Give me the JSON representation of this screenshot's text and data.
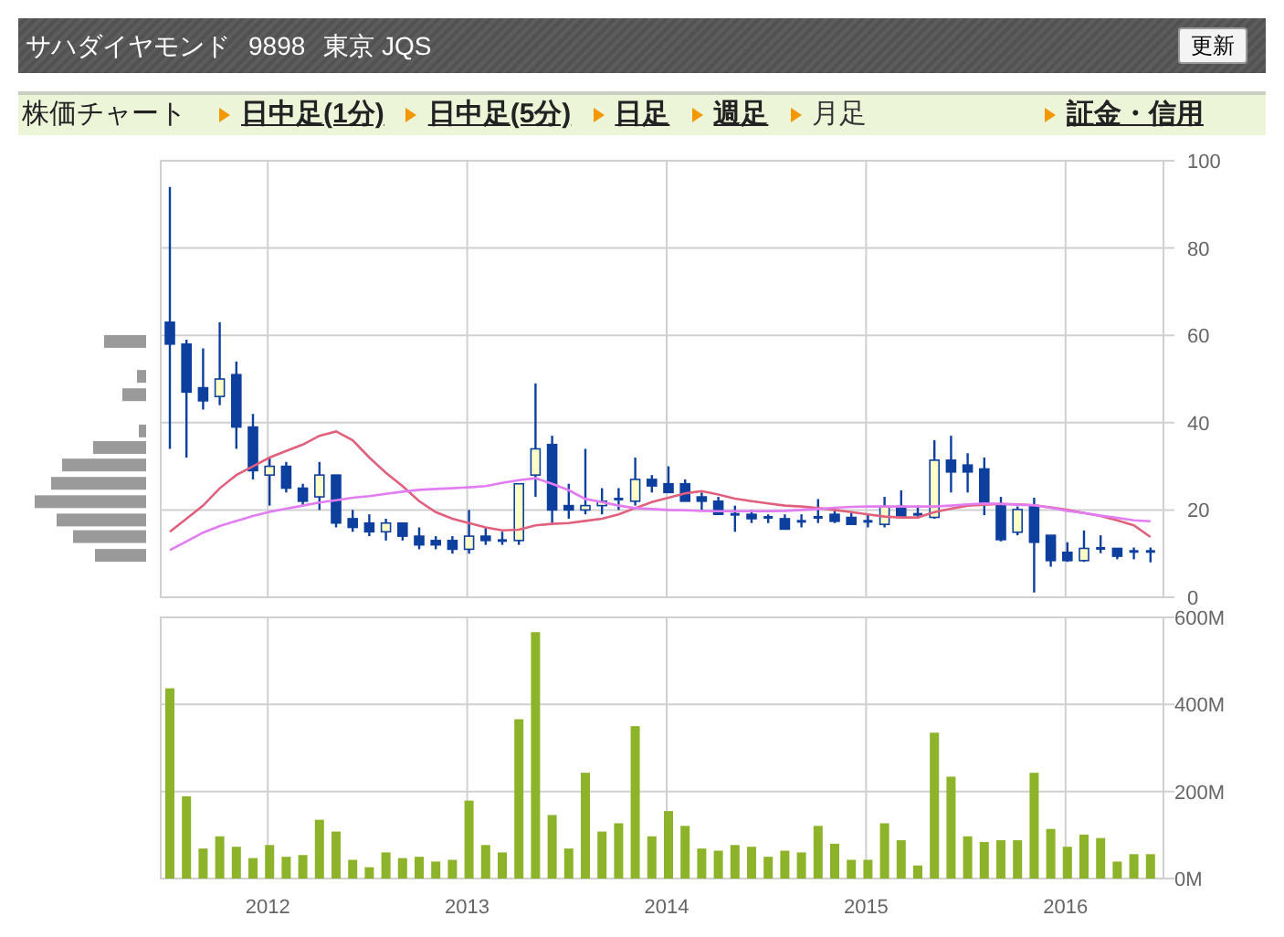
{
  "header": {
    "company": "サハダイヤモンド",
    "code": "9898",
    "market": "東京 JQS",
    "refresh_button": "更新"
  },
  "nav": {
    "label": "株価チャート",
    "links": [
      {
        "label": "日中足(1分)",
        "selected": false
      },
      {
        "label": "日中足(5分)",
        "selected": false
      },
      {
        "label": "日足",
        "selected": false
      },
      {
        "label": "週足",
        "selected": false
      },
      {
        "label": "月足",
        "selected": true
      },
      {
        "label": "証金・信用",
        "selected": false
      }
    ]
  },
  "price_chart": {
    "chart_data": {
      "type": "candlestick",
      "categories": [
        null,
        null,
        null,
        null,
        null,
        null,
        null,
        null,
        null,
        null,
        null,
        null,
        null,
        null,
        null,
        null,
        null,
        null,
        null,
        null,
        null,
        null,
        null,
        null,
        null,
        null,
        null,
        null,
        null,
        null,
        null,
        null,
        null,
        null,
        null,
        null,
        null,
        null,
        null,
        null,
        null,
        null,
        null,
        null,
        null,
        null,
        null,
        null,
        null,
        null,
        null,
        null,
        null,
        null,
        null,
        null,
        null,
        null,
        null,
        null
      ],
      "ylim": [
        0,
        100
      ],
      "yticks": [
        {
          "value": 0,
          "label": "0"
        },
        {
          "value": 20,
          "label": "20"
        },
        {
          "value": 40,
          "label": "40"
        },
        {
          "value": 60,
          "label": "60"
        },
        {
          "value": 80,
          "label": "80"
        },
        {
          "value": 100,
          "label": "100"
        }
      ],
      "grid": true,
      "ohlc": [
        [
          63,
          94,
          34,
          58
        ],
        [
          58,
          59,
          32,
          47
        ],
        [
          48,
          57,
          43,
          45
        ],
        [
          46,
          63,
          44,
          50
        ],
        [
          51,
          54,
          34,
          39
        ],
        [
          39,
          42,
          27,
          29
        ],
        [
          28,
          32,
          21,
          30
        ],
        [
          30,
          31,
          24,
          25
        ],
        [
          25,
          26,
          21,
          22
        ],
        [
          23,
          31,
          20,
          28
        ],
        [
          28,
          28,
          16,
          17
        ],
        [
          18,
          20,
          15,
          16
        ],
        [
          17,
          19,
          14,
          15
        ],
        [
          15,
          18,
          13,
          17
        ],
        [
          17,
          17,
          13,
          14
        ],
        [
          14,
          16,
          11,
          12
        ],
        [
          13,
          14,
          11,
          12
        ],
        [
          13,
          14,
          10,
          11
        ],
        [
          11,
          20,
          10,
          14
        ],
        [
          14,
          16,
          12,
          13
        ],
        [
          13,
          15,
          12,
          13
        ],
        [
          13,
          26,
          12,
          26
        ],
        [
          28,
          49,
          23,
          34
        ],
        [
          35,
          37,
          17,
          20
        ],
        [
          21,
          26,
          18,
          20
        ],
        [
          20,
          34,
          19,
          21
        ],
        [
          21,
          25,
          19,
          22
        ],
        [
          22.5,
          25,
          20,
          22.5
        ],
        [
          22,
          32,
          21,
          27
        ],
        [
          27,
          28,
          24,
          25.5
        ],
        [
          26,
          30,
          24,
          24
        ],
        [
          26,
          27,
          22,
          22
        ],
        [
          23,
          24,
          20,
          22
        ],
        [
          22,
          23,
          19,
          19
        ],
        [
          19,
          21,
          15,
          19
        ],
        [
          19,
          20,
          17,
          18
        ],
        [
          18.3,
          19,
          17,
          18.3
        ],
        [
          18,
          19,
          15.6,
          15.6
        ],
        [
          17.4,
          19,
          16,
          17.4
        ],
        [
          18.3,
          22.5,
          17,
          18.3
        ],
        [
          19,
          20,
          17,
          17.4
        ],
        [
          18.3,
          19.7,
          16.7,
          16.7
        ],
        [
          17.4,
          19,
          16,
          17.4
        ],
        [
          16.7,
          23,
          16,
          20.8
        ],
        [
          20.8,
          24.5,
          18,
          18.3
        ],
        [
          19,
          21,
          18,
          19
        ],
        [
          18.3,
          36,
          18,
          31.4
        ],
        [
          31.4,
          37,
          24,
          28.7
        ],
        [
          30.3,
          33,
          24,
          28.7
        ],
        [
          29.4,
          32,
          18.8,
          21.5
        ],
        [
          21,
          23,
          12.8,
          13.2
        ],
        [
          14.9,
          20.8,
          14.2,
          20.1
        ],
        [
          20.8,
          22.8,
          1.1,
          12.6
        ],
        [
          14.2,
          14.2,
          7,
          8.4
        ],
        [
          10.3,
          12.6,
          8.1,
          8.4
        ],
        [
          8.4,
          15.3,
          8.1,
          11.2
        ],
        [
          11.2,
          14.2,
          10.1,
          11.2
        ],
        [
          11.2,
          11.2,
          8.7,
          9.4
        ],
        [
          10.5,
          11.4,
          8.7,
          10.5
        ],
        [
          10.5,
          11.4,
          8,
          10.5
        ]
      ],
      "series": [
        {
          "type": "line",
          "color": "#e0607e",
          "values": [
            15,
            18,
            21,
            25,
            28,
            30,
            32,
            33.5,
            35,
            37,
            38,
            36,
            32,
            28.5,
            25.5,
            22,
            19.5,
            18,
            17,
            16,
            15.3,
            15.5,
            16.5,
            16.8,
            17,
            17.5,
            18,
            19,
            20.4,
            21.8,
            22.8,
            23.8,
            24.3,
            23.5,
            22.6,
            22,
            21.5,
            21,
            20.8,
            20.4,
            20,
            19.5,
            19,
            18.5,
            18.3,
            18.3,
            19.5,
            20.3,
            21,
            21.2,
            21.4,
            21.3,
            21.1,
            20.6,
            20,
            19.3,
            18.6,
            17.6,
            16.5,
            13.8
          ]
        },
        {
          "type": "line",
          "color": "#e27cf2",
          "values": [
            10.8,
            12.8,
            14.8,
            16.3,
            17.5,
            18.6,
            19.6,
            20.3,
            21,
            21.7,
            22.2,
            22.8,
            23.2,
            23.7,
            24.2,
            24.6,
            24.8,
            25,
            25.2,
            25.5,
            26.2,
            26.8,
            27.3,
            26,
            24.5,
            22.5,
            21.8,
            21,
            20.4,
            20.2,
            20,
            19.9,
            19.8,
            19.7,
            19.7,
            19.7,
            19.7,
            19.8,
            20,
            20.2,
            20.5,
            20.7,
            20.8,
            20.8,
            20.8,
            20.8,
            20.8,
            21,
            21.3,
            21.5,
            21.4,
            21.2,
            21.1,
            20.5,
            19.8,
            19.3,
            18.7,
            18.2,
            17.6,
            17.4
          ]
        }
      ]
    }
  },
  "volume_chart": {
    "chart_data": {
      "type": "bar",
      "categories": [
        null,
        null,
        null,
        null,
        null,
        null,
        "2012",
        null,
        null,
        null,
        null,
        null,
        null,
        null,
        null,
        null,
        null,
        null,
        "2013",
        null,
        null,
        null,
        null,
        null,
        null,
        null,
        null,
        null,
        null,
        null,
        "2014",
        null,
        null,
        null,
        null,
        null,
        null,
        null,
        null,
        null,
        null,
        null,
        "2015",
        null,
        null,
        null,
        null,
        null,
        null,
        null,
        null,
        null,
        null,
        null,
        "2016",
        null,
        null,
        null,
        null,
        null
      ],
      "ylim": [
        0,
        600
      ],
      "yticks": [
        {
          "value": 0,
          "label": "0M"
        },
        {
          "value": 200,
          "label": "200M"
        },
        {
          "value": 400,
          "label": "400M"
        },
        {
          "value": 600,
          "label": "600M"
        }
      ],
      "grid": true,
      "series": [
        {
          "color": "#8db32a",
          "values": [
            437,
            189,
            69,
            97,
            73,
            47,
            77,
            50,
            54,
            135,
            108,
            43,
            26,
            60,
            47,
            50,
            39,
            43,
            179,
            77,
            60,
            366,
            566,
            146,
            69,
            243,
            108,
            127,
            350,
            97,
            155,
            121,
            69,
            64,
            77,
            73,
            50,
            64,
            60,
            121,
            80,
            43,
            43,
            127,
            88,
            30,
            335,
            234,
            97,
            84,
            88,
            88,
            243,
            114,
            73,
            101,
            93,
            39,
            56,
            56
          ]
        }
      ]
    }
  }
}
